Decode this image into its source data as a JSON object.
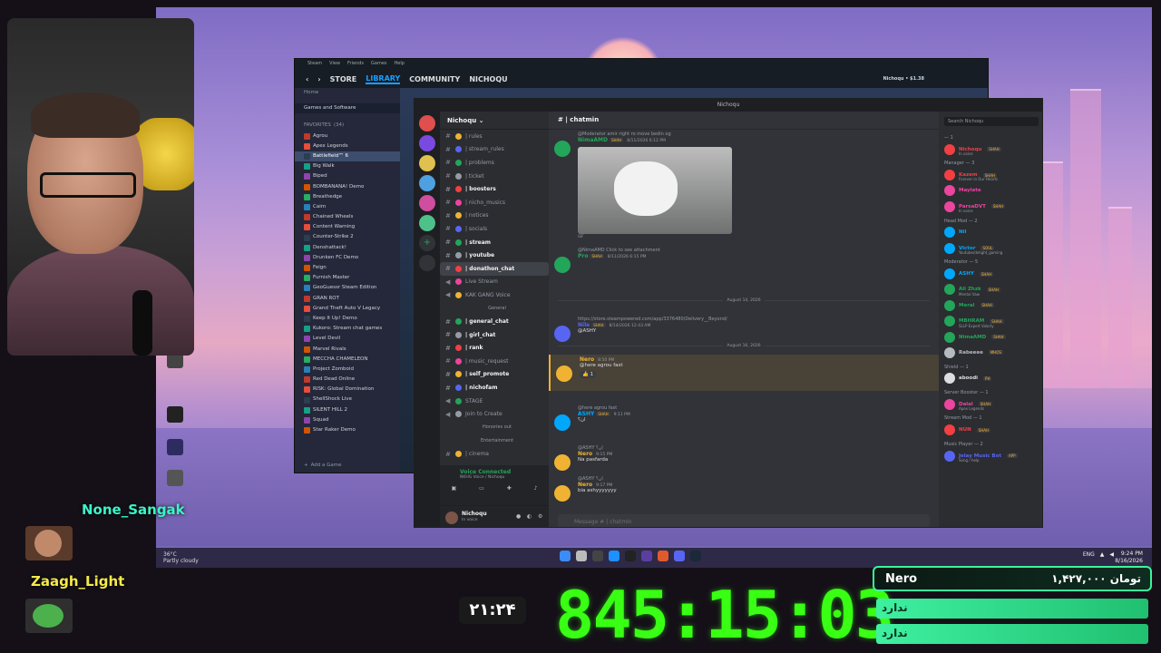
{
  "steam": {
    "menu": [
      "Steam",
      "View",
      "Friends",
      "Games",
      "Help"
    ],
    "nav": [
      "STORE",
      "LIBRARY",
      "COMMUNITY",
      "NICHOQU"
    ],
    "user": "Nichoqu",
    "balance": "$1.38",
    "home": "Home",
    "filter": "Games and Software",
    "favorites": "FAVORITES",
    "fav_count": "(34)",
    "add_game": "Add a Game",
    "games": [
      "Agrou",
      "Apex Legends",
      "Battlefield™ 6",
      "Big Walk",
      "Biped",
      "BOMBANANA! Demo",
      "Breathedge",
      "Cairn",
      "Chained Wheels",
      "Content Warning",
      "Counter-Strike 2",
      "Denshattack!",
      "Drunken FC Demo",
      "Feign",
      "Furnish Master",
      "GeoGuessr Steam Edition",
      "GRAN ROT",
      "Grand Theft Auto V Legacy",
      "Keep It Up! Demo",
      "Kukoro: Stream chat games",
      "Level Devil",
      "Marvel Rivals",
      "MECCHA CHAMELEON",
      "Project Zomboid",
      "Red Dead Online",
      "RISK: Global Domination",
      "ShellShock Live",
      "SILENT HILL 2",
      "Squad",
      "Star Raker Demo"
    ]
  },
  "discord": {
    "window_title": "Nichoqu",
    "server_name": "Nichoqu",
    "channels": [
      {
        "t": "text",
        "n": "| rules",
        "b": false
      },
      {
        "t": "text",
        "n": "| stream_rules",
        "b": false
      },
      {
        "t": "text",
        "n": "| problems",
        "b": false
      },
      {
        "t": "text",
        "n": "| ticket",
        "b": false
      },
      {
        "t": "text",
        "n": "| boosters",
        "b": true
      },
      {
        "t": "text",
        "n": "| nicho_musics",
        "b": false
      },
      {
        "t": "text",
        "n": "| notices",
        "b": false
      },
      {
        "t": "text",
        "n": "| socials",
        "b": false
      },
      {
        "t": "text",
        "n": "| stream",
        "b": true
      },
      {
        "t": "text",
        "n": "| youtube",
        "b": true
      },
      {
        "t": "text",
        "n": "| donathon_chat",
        "b": true,
        "active": true
      },
      {
        "t": "voice",
        "n": "Live Stream",
        "b": false
      },
      {
        "t": "voice",
        "n": "KAK GANG Voice",
        "b": false
      },
      {
        "t": "cat",
        "n": "General"
      },
      {
        "t": "text",
        "n": "| general_chat",
        "b": true
      },
      {
        "t": "text",
        "n": "| girl_chat",
        "b": true
      },
      {
        "t": "text",
        "n": "| rank",
        "b": true
      },
      {
        "t": "text",
        "n": "| music_request",
        "b": false
      },
      {
        "t": "text",
        "n": "| self_promote",
        "b": true
      },
      {
        "t": "text",
        "n": "| nichofam",
        "b": true
      },
      {
        "t": "voice",
        "n": "STAGE",
        "b": false
      },
      {
        "t": "voice",
        "n": "Join to Create",
        "b": false
      },
      {
        "t": "cat",
        "n": "Honories out"
      },
      {
        "t": "cat",
        "n": "Entertainment"
      },
      {
        "t": "text",
        "n": "| cinema",
        "b": false
      }
    ],
    "voice": {
      "status": "Voice Connected",
      "channel": "NKHG Voice / Nichoqu"
    },
    "user": {
      "name": "Nichoqu",
      "status": "In voice"
    },
    "chat_channel": "| chatmin",
    "composer": "Message # | chatmin",
    "messages": [
      {
        "reply": "@Moderator amir right ro move bedin og",
        "name": "NimaAMD",
        "badge": "SHAH",
        "ts": "8/11/2026 6:12 PM",
        "text": "",
        "gif": "GIF",
        "color": "#23a55a"
      },
      {
        "reply": "@NimaAMD  Click to see attachment",
        "name": "Pro",
        "badge": "SHAH",
        "ts": "8/11/2026 6:15 PM",
        "text": "",
        "color": "#23a55a"
      },
      {
        "date": "August 14, 2026"
      },
      {
        "reply": "https://store.steampowered.com/app/3376480/Delivery__Beyond/",
        "name": "Nile",
        "badge": "SHAH",
        "ts": "8/14/2026 12:43 AM",
        "text": "@ASHY",
        "color": "#5865f2"
      },
      {
        "date": "August 16, 2026"
      },
      {
        "reply": "",
        "name": "Nero",
        "badge": "",
        "ts": "8:50 PM",
        "text": "@here agrou fast",
        "color": "#f0b232",
        "reaction": "1"
      },
      {
        "reply": "@here agrou fast",
        "name": "ASHY",
        "badge": "SHAH",
        "ts": "9:11 PM",
        "text": "ان؟",
        "color": "#00a8fc"
      },
      {
        "reply": "@ASHY ان؟",
        "name": "Nero",
        "badge": "",
        "ts": "9:15 PM",
        "text": "Na pasfarda",
        "color": "#f0b232"
      },
      {
        "reply": "@ASHY ان؟",
        "name": "Nero",
        "badge": "",
        "ts": "9:17 PM",
        "text": "bia ashyyyyyyy",
        "color": "#f0b232"
      }
    ],
    "members_search": "Search Nichoqu",
    "member_groups": [
      {
        "cat": "— 1",
        "members": [
          {
            "n": "Nichoqu",
            "b": "SHAH",
            "s": "In voice",
            "c": "#f23f43"
          }
        ]
      },
      {
        "cat": "Manager — 3",
        "members": [
          {
            "n": "Kazem",
            "b": "SHAH",
            "s": "Forever in Our Hearts",
            "c": "#f23f43"
          },
          {
            "n": "Maylate",
            "b": "",
            "s": "",
            "c": "#eb459e"
          },
          {
            "n": "ParsaDVT",
            "b": "SHAH",
            "s": "In voice",
            "c": "#eb459e"
          }
        ]
      },
      {
        "cat": "Head Mod — 2",
        "members": [
          {
            "n": "Nil",
            "b": "",
            "s": "",
            "c": "#00a8fc"
          },
          {
            "n": "Victor",
            "b": "SOUL",
            "s": "Youtube/delight_gaming",
            "c": "#00a8fc"
          }
        ]
      },
      {
        "cat": "Moderator — 5",
        "members": [
          {
            "n": "ASHY",
            "b": "SHAH",
            "s": "",
            "c": "#00a8fc"
          },
          {
            "n": "Ali Zhzk",
            "b": "SHAH",
            "s": "Mental Vaw",
            "c": "#23a55a"
          },
          {
            "n": "Meral",
            "b": "SHAH",
            "s": "",
            "c": "#23a55a"
          },
          {
            "n": "MBHRAM",
            "b": "SHAH",
            "s": "SLLP Expert Valorly",
            "c": "#23a55a"
          },
          {
            "n": "NimaAMD",
            "b": "SHAH",
            "s": "",
            "c": "#23a55a"
          }
        ]
      },
      {
        "cat": "",
        "members": [
          {
            "n": "Rabeeee",
            "b": "MHOS",
            "s": "",
            "c": "#b5bac1"
          }
        ]
      },
      {
        "cat": "Shield — 1",
        "members": [
          {
            "n": "aboodi",
            "b": "PH",
            "s": "",
            "c": "#dbdee1"
          }
        ]
      },
      {
        "cat": "Server Booster — 1",
        "members": [
          {
            "n": "Dalal",
            "b": "SHAH",
            "s": "Apex Legends",
            "c": "#eb459e"
          }
        ]
      },
      {
        "cat": "Stream Mod — 1",
        "members": [
          {
            "n": "NUN",
            "b": "SHAH",
            "s": "",
            "c": "#f23f43"
          }
        ]
      },
      {
        "cat": "Music Player — 2",
        "members": [
          {
            "n": "Jelay Music Bot",
            "b": "APP",
            "s": "Song / help",
            "c": "#5865f2"
          }
        ]
      }
    ]
  },
  "taskbar": {
    "weather_temp": "36°C",
    "weather_desc": "Partly cloudy",
    "lang": "ENG",
    "time": "9:24 PM",
    "date": "8/16/2026"
  },
  "overlay": {
    "viewer1": "None_Sangak",
    "viewer2": "Zaagh_Light",
    "clock": "۲۱:۲۴",
    "timer": "845:15:03",
    "donor_name": "Nero",
    "donor_amount": "تومان ۱,۴۲۷,۰۰۰",
    "goal1": "ندارد",
    "goal2": "ندارد"
  }
}
